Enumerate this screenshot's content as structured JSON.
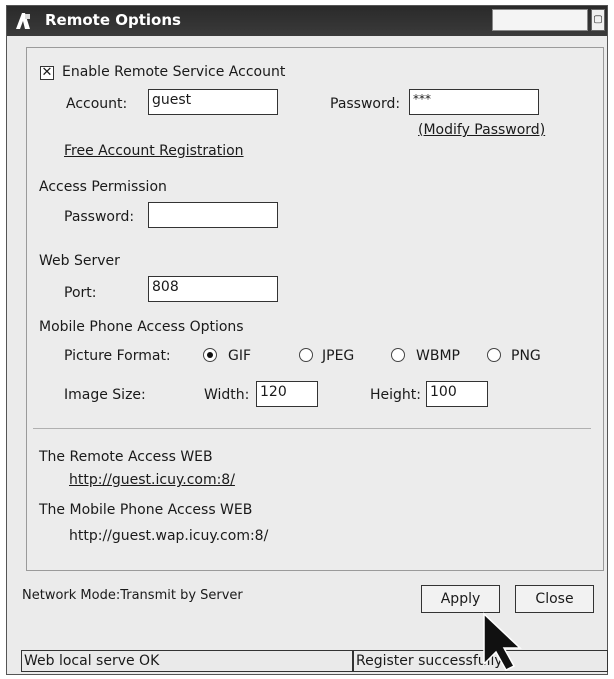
{
  "window": {
    "title": "Remote Options"
  },
  "remote_account": {
    "enable_label": "Enable Remote Service Account",
    "enable_checked": true,
    "account_label": "Account:",
    "account_value": "guest",
    "password_label": "Password:",
    "password_value": "***",
    "modify_password_link": "(Modify Password)",
    "free_registration_link": "Free Account Registration"
  },
  "access_permission": {
    "heading": "Access Permission",
    "password_label": "Password:",
    "password_value": ""
  },
  "web_server": {
    "heading": "Web Server",
    "port_label": "Port:",
    "port_value": "808"
  },
  "mobile_options": {
    "heading": "Mobile Phone Access Options",
    "picture_format_label": "Picture Format:",
    "formats": [
      {
        "label": "GIF",
        "selected": true
      },
      {
        "label": "JPEG",
        "selected": false
      },
      {
        "label": "WBMP",
        "selected": false
      },
      {
        "label": "PNG",
        "selected": false
      }
    ],
    "image_size_label": "Image Size:",
    "width_label": "Width:",
    "width_value": "120",
    "height_label": "Height:",
    "height_value": "100"
  },
  "remote_web": {
    "heading": "The Remote Access WEB",
    "url": "http://guest.icuy.com:8/"
  },
  "mobile_web": {
    "heading": "The Mobile Phone Access WEB",
    "url": "http://guest.wap.icuy.com:8/"
  },
  "footer": {
    "network_mode": "Network Mode:Transmit by Server",
    "apply_label": "Apply",
    "close_label": "Close"
  },
  "statusbar": {
    "left": "Web local  serve OK",
    "right": "Register successfully"
  },
  "icons": [
    "app-icon",
    "restore-icon",
    "mouse-cursor-icon"
  ]
}
